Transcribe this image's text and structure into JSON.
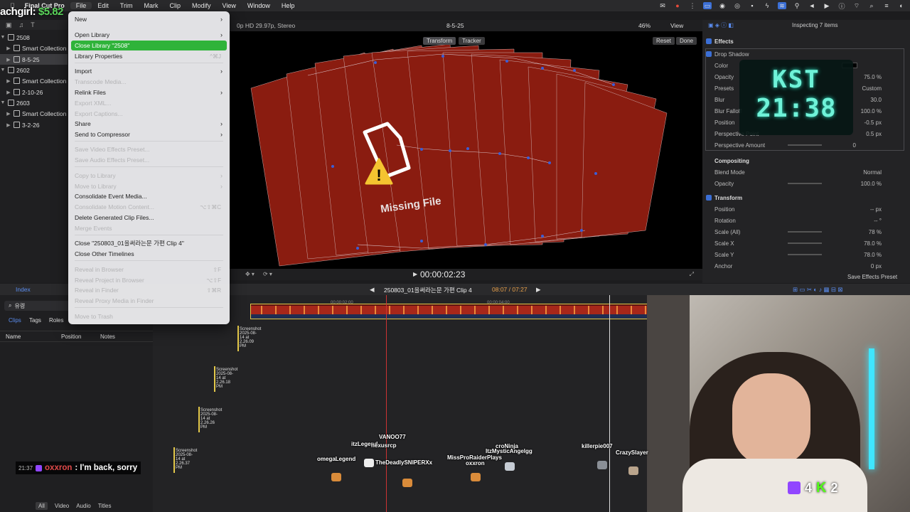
{
  "menubar": {
    "app": "Final Cut Pro",
    "items": [
      "File",
      "Edit",
      "Trim",
      "Mark",
      "Clip",
      "Modify",
      "View",
      "Window",
      "Help"
    ],
    "active": "File"
  },
  "stream": {
    "name": "achgirl:",
    "money": "$5.82"
  },
  "sidebar": {
    "libraries": [
      {
        "label": "2508",
        "level": 0,
        "open": true
      },
      {
        "label": "Smart Collection",
        "level": 1
      },
      {
        "label": "8-5-25",
        "level": 1,
        "selected": true
      },
      {
        "label": "2602",
        "level": 0,
        "open": true
      },
      {
        "label": "Smart Collection",
        "level": 1
      },
      {
        "label": "2-10-26",
        "level": 1
      },
      {
        "label": "2603",
        "level": 0,
        "open": true
      },
      {
        "label": "Smart Collection",
        "level": 1
      },
      {
        "label": "3-2-26",
        "level": 1
      }
    ]
  },
  "file_menu": {
    "items": [
      {
        "label": "New",
        "arrow": true
      },
      {
        "label": "Open Library",
        "arrow": true
      },
      {
        "label": "Close Library \"2508\"",
        "highlight": true
      },
      {
        "label": "Library Properties",
        "shortcut": "^⌘J"
      },
      {
        "sep": true
      },
      {
        "label": "Import",
        "arrow": true
      },
      {
        "label": "Transcode Media...",
        "disabled": true
      },
      {
        "label": "Relink Files",
        "arrow": true
      },
      {
        "label": "Export XML...",
        "disabled": true
      },
      {
        "label": "Export Captions...",
        "disabled": true
      },
      {
        "label": "Share",
        "arrow": true
      },
      {
        "label": "Send to Compressor",
        "arrow": true
      },
      {
        "sep": true
      },
      {
        "label": "Save Video Effects Preset...",
        "disabled": true
      },
      {
        "label": "Save Audio Effects Preset...",
        "disabled": true
      },
      {
        "sep": true
      },
      {
        "label": "Copy to Library",
        "disabled": true,
        "arrow": true
      },
      {
        "label": "Move to Library",
        "disabled": true,
        "arrow": true
      },
      {
        "label": "Consolidate Event Media..."
      },
      {
        "label": "Consolidate Motion Content...",
        "disabled": true,
        "shortcut": "⌥⇧⌘C"
      },
      {
        "label": "Delete Generated Clip Files..."
      },
      {
        "label": "Merge Events",
        "disabled": true
      },
      {
        "sep": true
      },
      {
        "label": "Close \"250803_01을써라는문 가편 Clip 4\""
      },
      {
        "label": "Close Other Timelines"
      },
      {
        "sep": true
      },
      {
        "label": "Reveal in Browser",
        "disabled": true,
        "shortcut": "⇧F"
      },
      {
        "label": "Reveal Project in Browser",
        "disabled": true,
        "shortcut": "⌥⇧F"
      },
      {
        "label": "Reveal in Finder",
        "disabled": true,
        "shortcut": "⇧⌘R"
      },
      {
        "label": "Reveal Proxy Media in Finder",
        "disabled": true
      },
      {
        "sep": true
      },
      {
        "label": "Move to Trash",
        "disabled": true
      }
    ]
  },
  "viewer": {
    "format": "0p HD 29.97p, Stereo",
    "title": "8-5-25",
    "zoom": "46%",
    "view_label": "View",
    "transform_label": "Transform",
    "tracker_label": "Tracker",
    "reset_label": "Reset",
    "done_label": "Done",
    "missing_label": "Missing File",
    "timecode": "00:00:02:23"
  },
  "inspector": {
    "header": "Inspecting 7 items",
    "effects_label": "Effects",
    "drop_shadow": "Drop Shadow",
    "rows": [
      {
        "label": "Color",
        "value": ""
      },
      {
        "label": "Opacity",
        "value": "75.0 %"
      },
      {
        "label": "Presets",
        "value": "Custom"
      },
      {
        "label": "Blur",
        "value": "30.0"
      },
      {
        "label": "Blur Falloff",
        "value": "100.0 %"
      },
      {
        "label": "Position",
        "value": "-0.5 px"
      },
      {
        "label": "Perspective Point",
        "value": "0.5 px"
      },
      {
        "label": "Perspective Amount",
        "value": "0"
      }
    ],
    "compositing": "Compositing",
    "blend_mode_label": "Blend Mode",
    "blend_mode_value": "Normal",
    "comp_opacity_label": "Opacity",
    "comp_opacity_value": "100.0 %",
    "transform": "Transform",
    "transform_rows": [
      {
        "label": "Position",
        "value": "-- px"
      },
      {
        "label": "Rotation",
        "value": "-- °"
      },
      {
        "label": "Scale (All)",
        "value": "78 %"
      },
      {
        "label": "Scale X",
        "value": "78.0 %"
      },
      {
        "label": "Scale Y",
        "value": "78.0 %"
      },
      {
        "label": "Anchor",
        "value": "0 px"
      }
    ],
    "save_preset": "Save Effects Preset"
  },
  "clock": {
    "tz": "KST",
    "time": "21:38"
  },
  "timeline": {
    "index_label": "Index",
    "search_text": "유령",
    "tabs": [
      "Clips",
      "Tags",
      "Roles"
    ],
    "columns": [
      "Name",
      "Position",
      "Notes"
    ],
    "project": "250803_01을써라는문 가편 Clip 4",
    "duration": "08:07 / 07:27",
    "ruler": [
      "00:00:02:00",
      "00:00:04:00"
    ],
    "clips": [
      "Screenshot 2025-08-14 at 2.26.09 PM",
      "Screenshot 2025-08-14 at 2.26.18 PM",
      "Screenshot 2025-08-14 at 2.26.26 PM",
      "Screenshot 2025-08-14 at 2.26.37 PM"
    ],
    "filters": [
      "All",
      "Video",
      "Audio",
      "Titles"
    ]
  },
  "overlay_users": [
    "VANOO77",
    "itzLegend",
    "nexusrcp",
    "omegaLegend",
    "TheDeadlySNIPERXx",
    "MissProRaiderPlays",
    "oxxron",
    "croNinja",
    "ItzMysticAngelgg",
    "killerpie007",
    "CrazySlayer"
  ],
  "chat": {
    "time": "21:37",
    "user": "oxxron",
    "message": ": I'm back, sorry"
  },
  "viewer_counts": {
    "twitch": "4",
    "kick": "2"
  }
}
